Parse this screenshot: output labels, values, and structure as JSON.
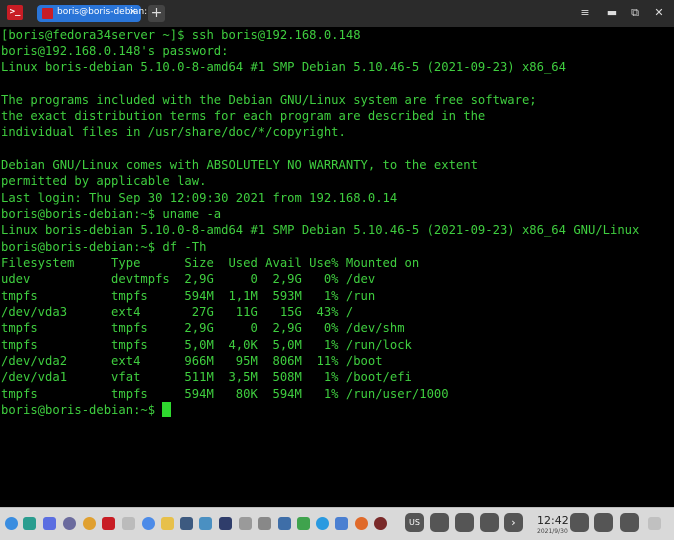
{
  "titlebar": {
    "tab_title": "boris@boris-debian: ~",
    "tab_close": "×",
    "new_tab": "+",
    "minimize": "▬",
    "maximize": "□",
    "restore": "⧉",
    "close": "✕"
  },
  "terminal": {
    "lines": [
      "[boris@fedora34server ~]$ ssh boris@192.168.0.148",
      "boris@192.168.0.148's password:",
      "Linux boris-debian 5.10.0-8-amd64 #1 SMP Debian 5.10.46-5 (2021-09-23) x86_64",
      "",
      "The programs included with the Debian GNU/Linux system are free software;",
      "the exact distribution terms for each program are described in the",
      "individual files in /usr/share/doc/*/copyright.",
      "",
      "Debian GNU/Linux comes with ABSOLUTELY NO WARRANTY, to the extent",
      "permitted by applicable law.",
      "Last login: Thu Sep 30 12:09:30 2021 from 192.168.0.14",
      "boris@boris-debian:~$ uname -a",
      "Linux boris-debian 5.10.0-8-amd64 #1 SMP Debian 5.10.46-5 (2021-09-23) x86_64 GNU/Linux",
      "boris@boris-debian:~$ df -Th",
      "Filesystem     Type      Size  Used Avail Use% Mounted on",
      "udev           devtmpfs  2,9G     0  2,9G   0% /dev",
      "tmpfs          tmpfs     594M  1,1M  593M   1% /run",
      "/dev/vda3      ext4       27G   11G   15G  43% /",
      "tmpfs          tmpfs     2,9G     0  2,9G   0% /dev/shm",
      "tmpfs          tmpfs     5,0M  4,0K  5,0M   1% /run/lock",
      "/dev/vda2      ext4      966M   95M  806M  11% /boot",
      "/dev/vda1      vfat      511M  3,5M  508M   1% /boot/efi",
      "tmpfs          tmpfs     594M   80K  594M   1% /run/user/1000",
      "boris@boris-debian:~$ "
    ]
  },
  "taskbar": {
    "keyboard_layout": "US",
    "time": "12:42",
    "date": "2021/9/30"
  },
  "colors": {
    "terminal_text": "#3fce3f",
    "cursor": "#2fd92f",
    "tab_active": "#2a75d8",
    "app_icon": "#c81d25"
  }
}
